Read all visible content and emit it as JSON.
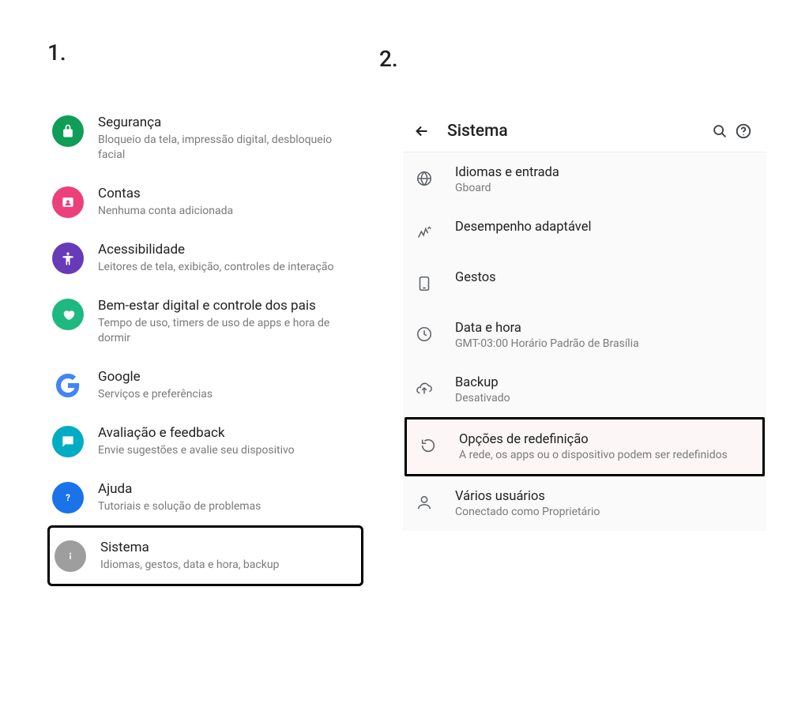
{
  "steps": {
    "one": "1.",
    "two": "2."
  },
  "left": {
    "items": [
      {
        "title": "Segurança",
        "subtitle": "Bloqueio da tela, impressão digital, desbloqueio facial",
        "icon": "lock",
        "bg": "#0f9d58"
      },
      {
        "title": "Contas",
        "subtitle": "Nenhuma conta adicionada",
        "icon": "account",
        "bg": "#ec407a"
      },
      {
        "title": "Acessibilidade",
        "subtitle": "Leitores de tela, exibição, controles de interação",
        "icon": "accessibility",
        "bg": "#673ab7"
      },
      {
        "title": "Bem-estar digital e controle dos pais",
        "subtitle": "Tempo de uso, timers de uso de apps e hora de dormir",
        "icon": "wellbeing",
        "bg": "#1eb980"
      },
      {
        "title": "Google",
        "subtitle": "Serviços e preferências",
        "icon": "google",
        "bg": "#ffffff"
      },
      {
        "title": "Avaliação e feedback",
        "subtitle": "Envie sugestões e avalie seu dispositivo",
        "icon": "feedback",
        "bg": "#00acc1"
      },
      {
        "title": "Ajuda",
        "subtitle": "Tutoriais e solução de problemas",
        "icon": "help",
        "bg": "#1a73e8"
      },
      {
        "title": "Sistema",
        "subtitle": "Idiomas, gestos, data e hora, backup",
        "icon": "info",
        "bg": "#9e9e9e"
      }
    ],
    "highlight_index": 7
  },
  "right": {
    "header_title": "Sistema",
    "items": [
      {
        "title": "Idiomas e entrada",
        "subtitle": "Gboard",
        "icon": "globe"
      },
      {
        "title": "Desempenho adaptável",
        "subtitle": "",
        "icon": "adaptive"
      },
      {
        "title": "Gestos",
        "subtitle": "",
        "icon": "gestures"
      },
      {
        "title": "Data e hora",
        "subtitle": "GMT-03:00 Horário Padrão de Brasília",
        "icon": "clock"
      },
      {
        "title": "Backup",
        "subtitle": "Desativado",
        "icon": "cloud-up"
      },
      {
        "title": "Opções de redefinição",
        "subtitle": "A rede, os apps ou o dispositivo podem ser redefinidos",
        "icon": "reset"
      },
      {
        "title": "Vários usuários",
        "subtitle": "Conectado como Proprietário",
        "icon": "user"
      }
    ],
    "highlight_index": 5
  }
}
